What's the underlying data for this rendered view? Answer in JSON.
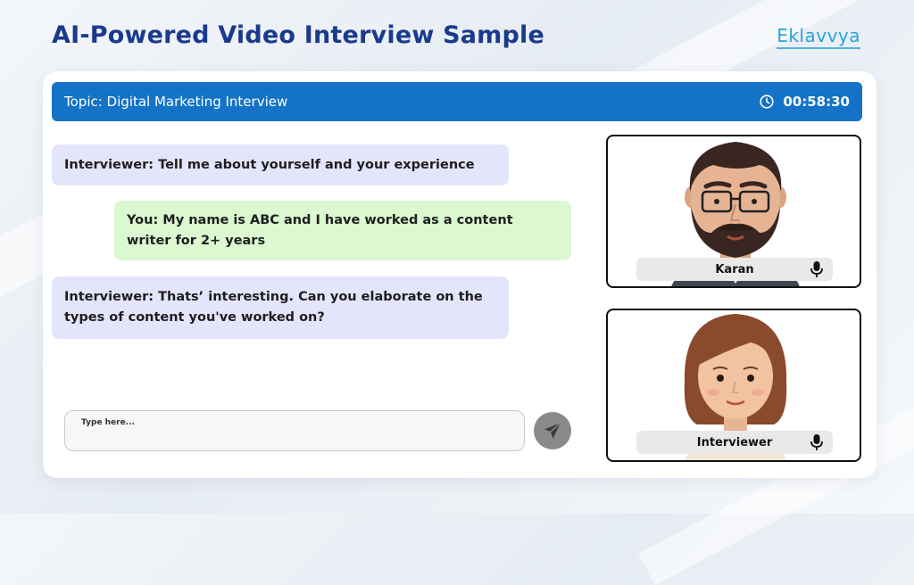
{
  "header": {
    "title": "AI-Powered Video Interview Sample",
    "brand": "Eklavvya"
  },
  "topic_bar": {
    "topic": "Topic: Digital Marketing Interview",
    "timer": "00:58:30",
    "timer_icon": "clock-icon"
  },
  "chat": {
    "messages": [
      {
        "sender": "interviewer",
        "text": "Interviewer: Tell me about yourself and your experience"
      },
      {
        "sender": "you",
        "text": "You: My name is ABC and I have worked as a content writer for 2+ years"
      },
      {
        "sender": "interviewer",
        "text": "Interviewer: Thats’ interesting. Can you elaborate on the types of content you've worked on?"
      }
    ],
    "input": {
      "placeholder": "Type here...",
      "value": ""
    },
    "send_icon": "send-icon"
  },
  "participants": [
    {
      "name": "Karan",
      "icon": "microphone-icon"
    },
    {
      "name": "Interviewer",
      "icon": "microphone-icon"
    }
  ],
  "colors": {
    "title": "#1a3a8c",
    "brand": "#29a3dc",
    "topic_bar": "#1473c6",
    "interviewer_bubble": "#e4e4fb",
    "you_bubble": "#dbf8d1",
    "send_button": "#8a8a8a"
  }
}
